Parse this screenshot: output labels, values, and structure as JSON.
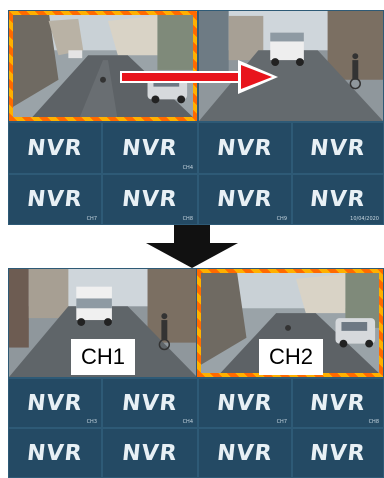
{
  "top_panel": {
    "highlighted_channel": "CH1",
    "nvr_cells": [
      {
        "logo": "NVR",
        "tag": ""
      },
      {
        "logo": "NVR",
        "tag": "CH4"
      },
      {
        "logo": "NVR",
        "tag": ""
      },
      {
        "logo": "NVR",
        "tag": ""
      },
      {
        "logo": "NVR",
        "tag": "CH7"
      },
      {
        "logo": "NVR",
        "tag": "CH8"
      },
      {
        "logo": "NVR",
        "tag": "CH9"
      },
      {
        "logo": "NVR",
        "tag": "10/04/2020"
      }
    ],
    "arrow_icon": "right-arrow-icon",
    "arrow_color": "#e8141c"
  },
  "transition": {
    "arrow_icon": "down-arrow-icon",
    "arrow_color": "#111111"
  },
  "bottom_panel": {
    "labels": {
      "ch1": "CH1",
      "ch2": "CH2"
    },
    "nvr_cells": [
      {
        "logo": "NVR",
        "tag": "CH3"
      },
      {
        "logo": "NVR",
        "tag": "CH4"
      },
      {
        "logo": "NVR",
        "tag": "CH7"
      },
      {
        "logo": "NVR",
        "tag": "CH8"
      },
      {
        "logo": "NVR",
        "tag": ""
      },
      {
        "logo": "NVR",
        "tag": ""
      },
      {
        "logo": "NVR",
        "tag": ""
      },
      {
        "logo": "NVR",
        "tag": ""
      }
    ]
  },
  "colors": {
    "panel_bg": "#1f3f57",
    "selection_border": "#ff6a00",
    "nvr_text": "#e8f0f5"
  }
}
